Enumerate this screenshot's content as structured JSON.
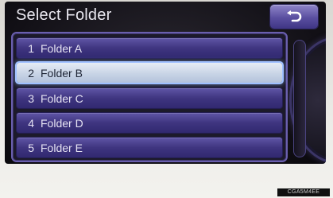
{
  "header": {
    "title": "Select Folder"
  },
  "back_button": {
    "icon": "back-arrow-icon"
  },
  "folders": [
    {
      "number": "1",
      "label": "Folder A",
      "selected": false
    },
    {
      "number": "2",
      "label": "Folder B",
      "selected": true
    },
    {
      "number": "3",
      "label": "Folder C",
      "selected": false
    },
    {
      "number": "4",
      "label": "Folder D",
      "selected": false
    },
    {
      "number": "5",
      "label": "Folder E",
      "selected": false
    }
  ],
  "footer": {
    "code": "CGA5M4EE"
  },
  "colors": {
    "row_blue": "#3f3580",
    "selected_row": "#c8d4e6",
    "accent_border": "#6a5fae"
  }
}
